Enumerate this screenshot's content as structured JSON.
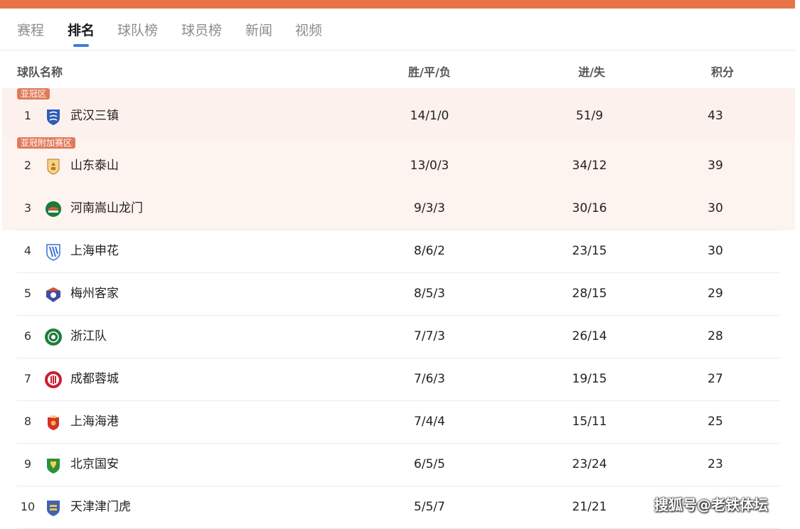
{
  "tabs": [
    "赛程",
    "排名",
    "球队榜",
    "球员榜",
    "新闻",
    "视频"
  ],
  "active_tab": "排名",
  "table": {
    "headers": {
      "team": "球队名称",
      "wdl": "胜/平/负",
      "goals": "进/失",
      "points": "积分"
    },
    "zones": {
      "acl": "亚冠区",
      "acl_playoff": "亚冠附加赛区"
    },
    "rows": [
      {
        "rank": "1",
        "team": "武汉三镇",
        "wdl": "14/1/0",
        "goals": "51/9",
        "points": "43",
        "logo": "wuhan-three-towns-logo"
      },
      {
        "rank": "2",
        "team": "山东泰山",
        "wdl": "13/0/3",
        "goals": "34/12",
        "points": "39",
        "logo": "shandong-taishan-logo"
      },
      {
        "rank": "3",
        "team": "河南嵩山龙门",
        "wdl": "9/3/3",
        "goals": "30/16",
        "points": "30",
        "logo": "henan-songshan-longmen-logo"
      },
      {
        "rank": "4",
        "team": "上海申花",
        "wdl": "8/6/2",
        "goals": "23/15",
        "points": "30",
        "logo": "shanghai-shenhua-logo"
      },
      {
        "rank": "5",
        "team": "梅州客家",
        "wdl": "8/5/3",
        "goals": "28/15",
        "points": "29",
        "logo": "meizhou-hakka-logo"
      },
      {
        "rank": "6",
        "team": "浙江队",
        "wdl": "7/7/3",
        "goals": "26/14",
        "points": "28",
        "logo": "zhejiang-logo"
      },
      {
        "rank": "7",
        "team": "成都蓉城",
        "wdl": "7/6/3",
        "goals": "19/15",
        "points": "27",
        "logo": "chengdu-rongcheng-logo"
      },
      {
        "rank": "8",
        "team": "上海海港",
        "wdl": "7/4/4",
        "goals": "15/11",
        "points": "25",
        "logo": "shanghai-port-logo"
      },
      {
        "rank": "9",
        "team": "北京国安",
        "wdl": "6/5/5",
        "goals": "23/24",
        "points": "23",
        "logo": "beijing-guoan-logo"
      },
      {
        "rank": "10",
        "team": "天津津门虎",
        "wdl": "5/5/7",
        "goals": "21/21",
        "points": "",
        "logo": "tianjin-jinmen-tiger-logo"
      }
    ]
  },
  "watermark": "搜狐号@老铁体坛",
  "colors": {
    "accent_bar": "#e8744a",
    "zone_bg": "#fdf1ed",
    "zone_badge": "#e07b5c",
    "tab_underline": "#3d7be0"
  }
}
